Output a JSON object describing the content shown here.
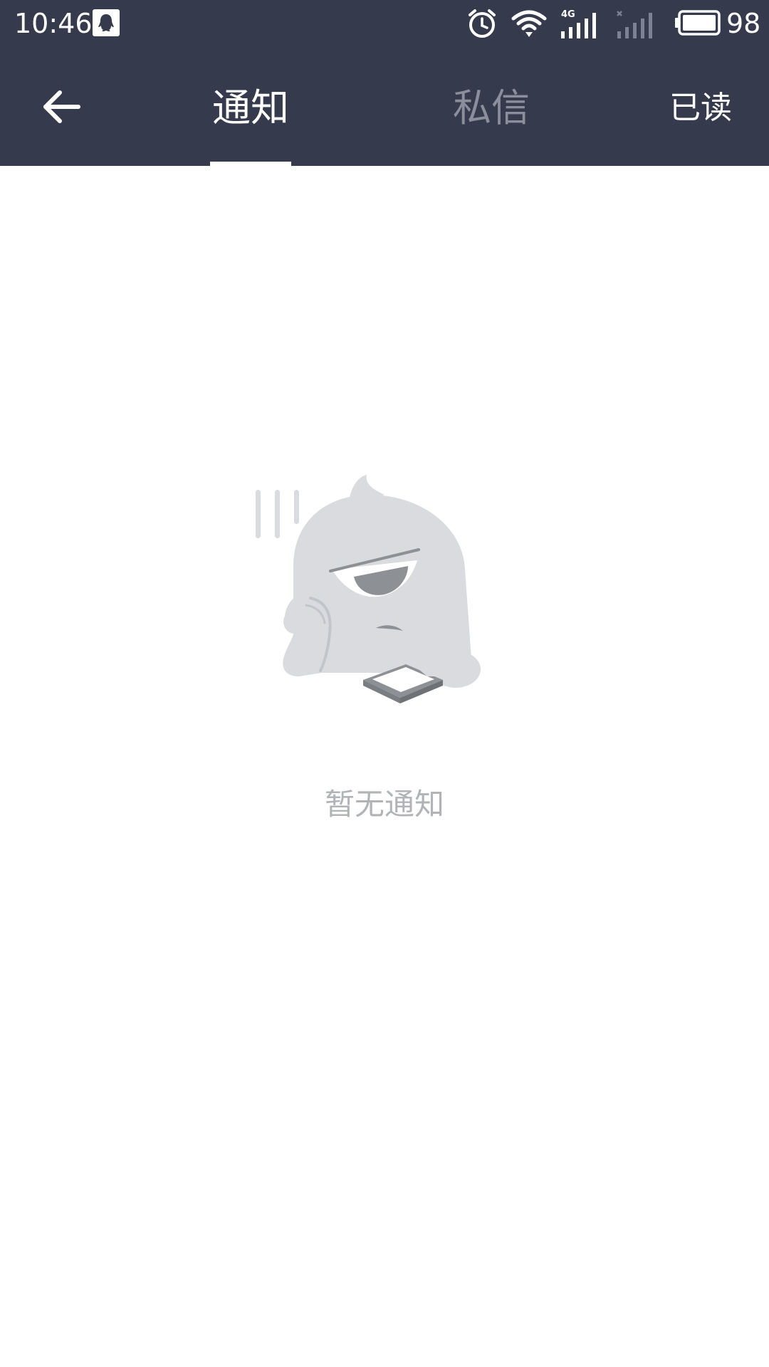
{
  "status_bar": {
    "time": "10:46",
    "network_label": "4G",
    "battery_level": "98",
    "icons": [
      "qq-icon",
      "alarm-icon",
      "wifi-icon",
      "signal-4g-icon",
      "signal-no-sim-icon",
      "battery-icon"
    ]
  },
  "app_bar": {
    "back_icon": "arrow-left-icon",
    "tabs": [
      {
        "label": "通知",
        "selected": true
      },
      {
        "label": "私信",
        "selected": false
      }
    ],
    "mark_read_label": "已读"
  },
  "empty_state": {
    "illustration": "bored-monster-with-phone",
    "text": "暂无通知"
  },
  "colors": {
    "header_bg": "#353a4c",
    "tab_active": "#ffffff",
    "tab_inactive": "#8b8f9c",
    "empty_text": "#b2b3b7",
    "illustration_body": "#d9dbde"
  }
}
